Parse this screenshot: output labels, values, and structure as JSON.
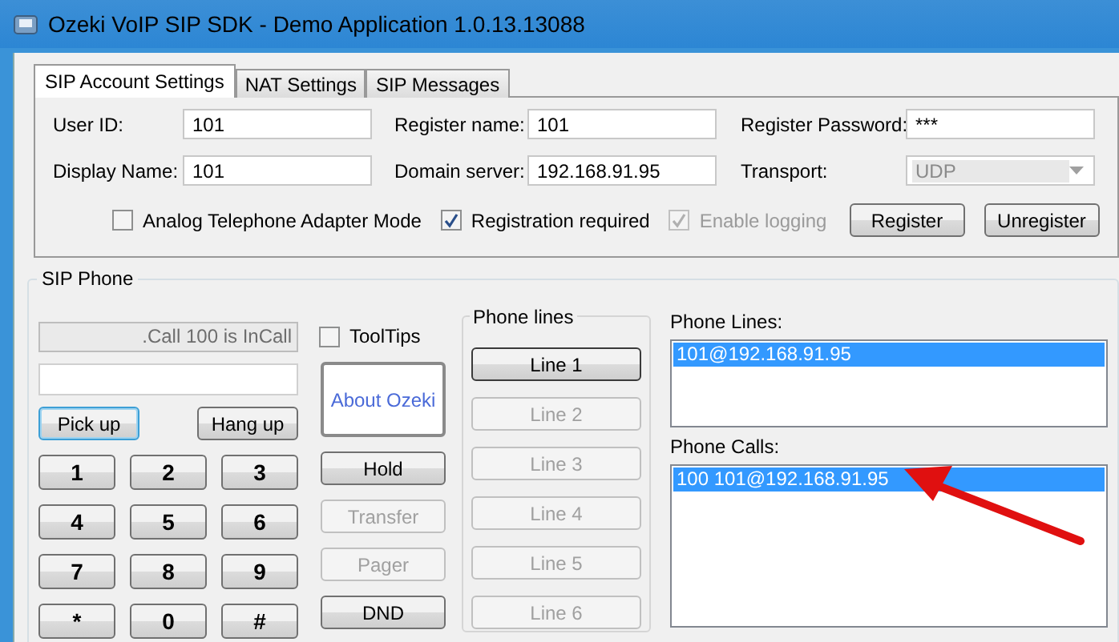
{
  "window": {
    "title": "Ozeki VoIP SIP SDK - Demo Application 1.0.13.13088"
  },
  "tabs": [
    {
      "label": "SIP Account Settings",
      "selected": true
    },
    {
      "label": "NAT Settings",
      "selected": false
    },
    {
      "label": "SIP Messages",
      "selected": false
    }
  ],
  "account": {
    "fields": [
      {
        "label": "User ID:",
        "value": "101",
        "kind": "text",
        "disabled": false
      },
      {
        "label": "Register name:",
        "value": "101",
        "kind": "text",
        "disabled": false
      },
      {
        "label": "Register Password:",
        "value": "***",
        "kind": "text",
        "disabled": false
      },
      {
        "label": "Display Name:",
        "value": "101",
        "kind": "text",
        "disabled": false
      },
      {
        "label": "Domain server:",
        "value": "192.168.91.95",
        "kind": "text",
        "disabled": false
      },
      {
        "label": "Transport:",
        "value": "UDP",
        "kind": "select",
        "disabled": true
      }
    ],
    "checkboxes": [
      {
        "label": "Analog Telephone Adapter Mode",
        "checked": false,
        "disabled": false
      },
      {
        "label": "Registration required",
        "checked": true,
        "disabled": false
      },
      {
        "label": "Enable logging",
        "checked": true,
        "disabled": true
      }
    ],
    "buttons": [
      "Register",
      "Unregister"
    ]
  },
  "phone": {
    "title": "SIP Phone",
    "status": ".Call 100 is InCall",
    "call_buttons": [
      {
        "label": "Pick up",
        "focused": true
      },
      {
        "label": "Hang up",
        "focused": false
      }
    ],
    "keypad": [
      "1",
      "2",
      "3",
      "4",
      "5",
      "6",
      "7",
      "8",
      "9",
      "*",
      "0",
      "#"
    ],
    "tooltips": {
      "label": "ToolTips",
      "checked": false
    },
    "side_buttons": [
      {
        "label": "About Ozeki",
        "kind": "link",
        "disabled": false
      },
      {
        "label": "Hold",
        "kind": "button",
        "disabled": false
      },
      {
        "label": "Transfer",
        "kind": "button",
        "disabled": true
      },
      {
        "label": "Pager",
        "kind": "button",
        "disabled": true
      },
      {
        "label": "DND",
        "kind": "button",
        "disabled": false
      }
    ],
    "phone_lines": {
      "title": "Phone lines",
      "lines": [
        {
          "label": "Line 1",
          "disabled": false
        },
        {
          "label": "Line 2",
          "disabled": true
        },
        {
          "label": "Line 3",
          "disabled": true
        },
        {
          "label": "Line 4",
          "disabled": true
        },
        {
          "label": "Line 5",
          "disabled": true
        },
        {
          "label": "Line 6",
          "disabled": true
        }
      ]
    },
    "lists": [
      {
        "label": "Phone Lines:",
        "items": [
          {
            "text": "101@192.168.91.95",
            "selected": true
          }
        ]
      },
      {
        "label": "Phone Calls:",
        "items": [
          {
            "text": "100 101@192.168.91.95",
            "selected": true
          }
        ]
      }
    ]
  }
}
